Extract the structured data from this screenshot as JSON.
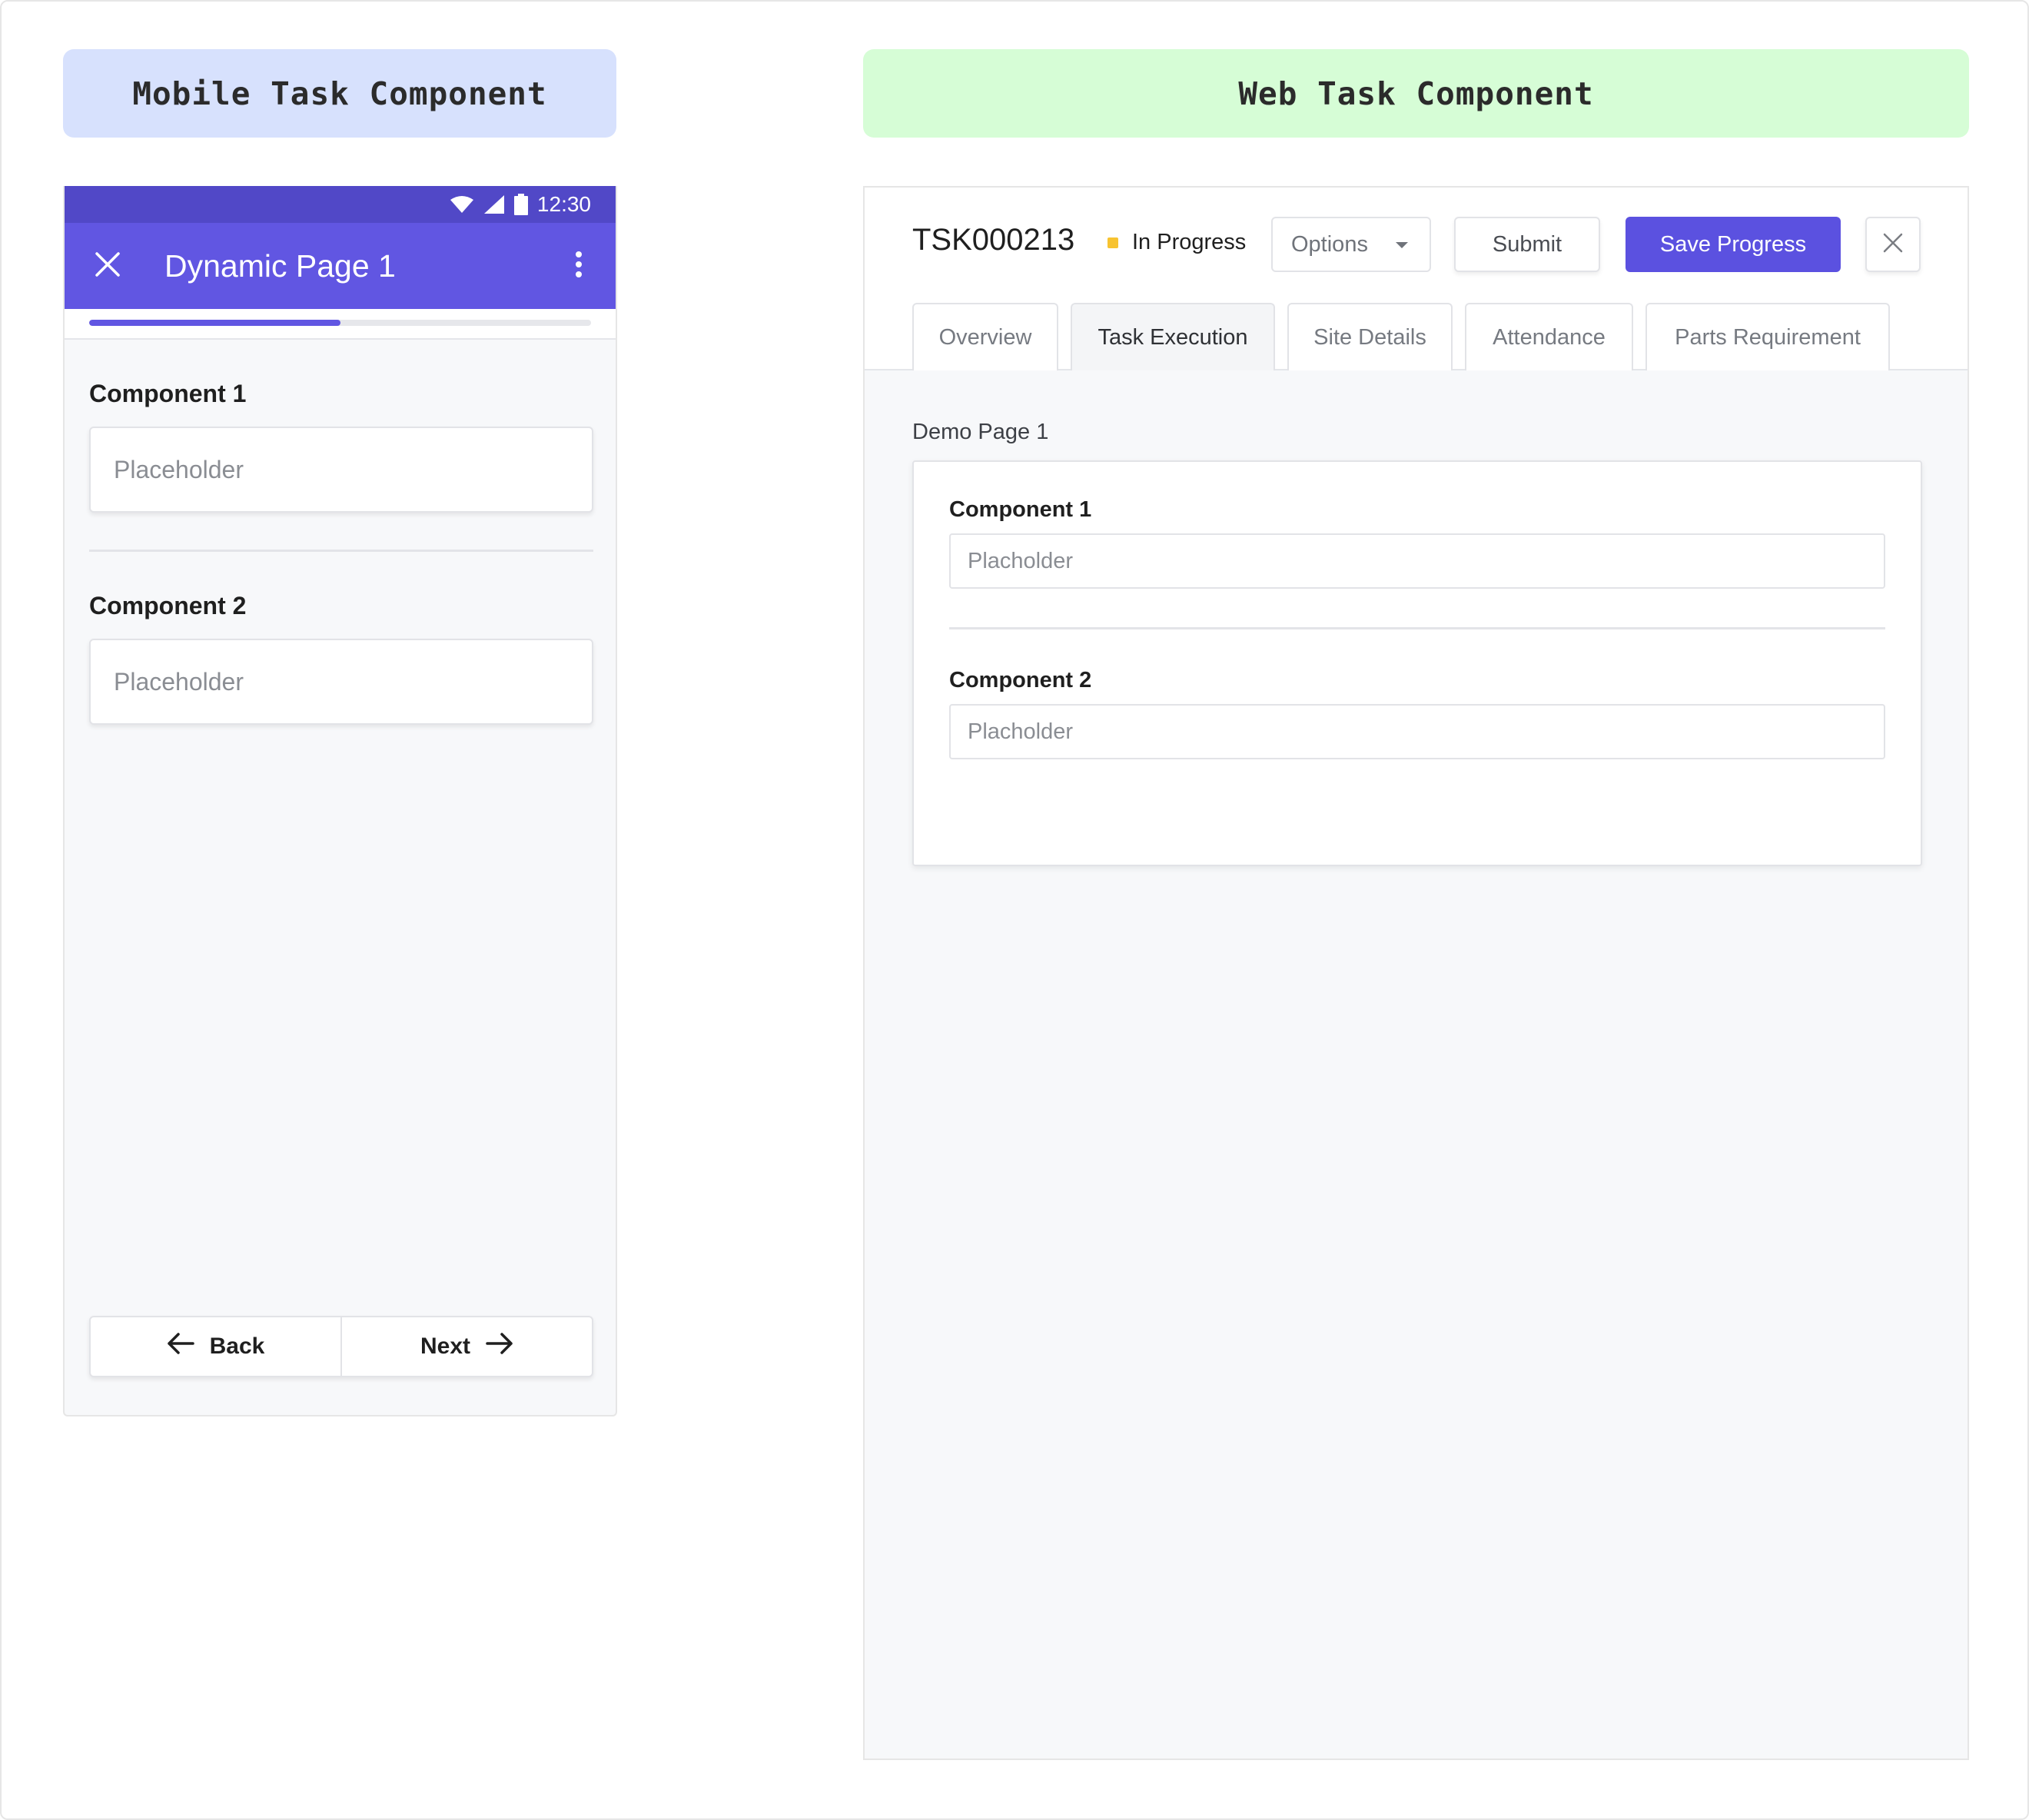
{
  "labels": {
    "mobile": "Mobile Task Component",
    "web": "Web Task Component"
  },
  "mobile": {
    "status_bar": {
      "time": "12:30"
    },
    "app_bar": {
      "title": "Dynamic Page 1",
      "close_icon": "close-icon",
      "more_icon": "more-vertical-icon"
    },
    "progress": 0.5,
    "components": [
      {
        "label": "Component 1",
        "placeholder": "Placeholder"
      },
      {
        "label": "Component 2",
        "placeholder": "Placeholder"
      }
    ],
    "nav": {
      "back_label": "Back",
      "next_label": "Next"
    },
    "colors": {
      "primary": "#6156e2",
      "status_bar": "#5148c7"
    }
  },
  "web": {
    "task_id": "TSK000213",
    "status": {
      "label": "In Progress",
      "color": "#f7c331"
    },
    "options": {
      "label": "Options"
    },
    "buttons": {
      "submit": "Submit",
      "save": "Save Progress",
      "close_icon": "close-icon"
    },
    "tabs": [
      {
        "label": "Overview",
        "active": false
      },
      {
        "label": "Task Execution",
        "active": true
      },
      {
        "label": "Site Details",
        "active": false
      },
      {
        "label": "Attendance",
        "active": false
      },
      {
        "label": "Parts Requirement",
        "active": false
      }
    ],
    "page_name": "Demo Page 1",
    "components": [
      {
        "label": "Component 1",
        "placeholder": "Placholder"
      },
      {
        "label": "Component 2",
        "placeholder": "Placholder"
      }
    ],
    "colors": {
      "primary": "#5b51e0"
    }
  }
}
